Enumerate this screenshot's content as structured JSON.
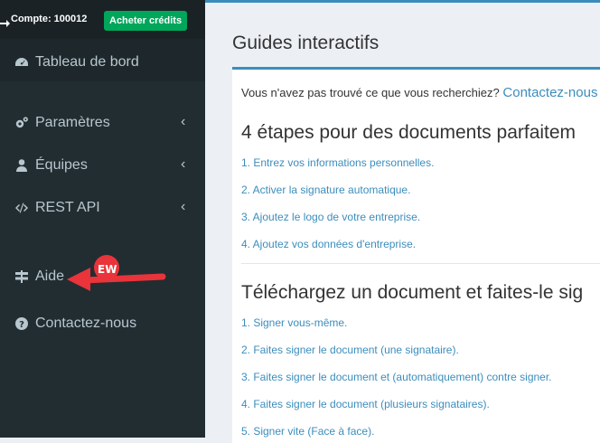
{
  "sidebar": {
    "account_label": "Compte: 100012",
    "buy_credits_label": "Acheter crédits",
    "items": [
      {
        "label": "Tableau de bord"
      },
      {
        "label": "Paramètres"
      },
      {
        "label": "Équipes"
      },
      {
        "label": "REST API"
      },
      {
        "label": "Aide"
      },
      {
        "label": "Contactez-nous"
      }
    ],
    "new_badge": "EW"
  },
  "main": {
    "page_title": "Guides interactifs",
    "intro_text": "Vous n'avez pas trouvé ce que vous recherchiez?",
    "intro_link": "Contactez-nous",
    "section1": {
      "title": "4 étapes pour des documents parfaitem",
      "links": [
        "1. Entrez vos informations personnelles.",
        "2. Activer la signature automatique.",
        "3. Ajoutez le logo de votre entreprise.",
        "4. Ajoutez vos données d'entreprise."
      ]
    },
    "section2": {
      "title": "Téléchargez un document et faites-le sig",
      "links": [
        "1. Signer vous-même.",
        "2. Faites signer le document (une signataire).",
        "3. Faites signer le document et (automatiquement) contre signer.",
        "4. Faites signer le document (plusieurs signataires).",
        "5. Signer vite (Face à face)."
      ]
    }
  },
  "colors": {
    "accent": "#3c8dbc",
    "sidebar": "#222d32",
    "button": "#00a65a",
    "annotation": "#e8343a"
  }
}
